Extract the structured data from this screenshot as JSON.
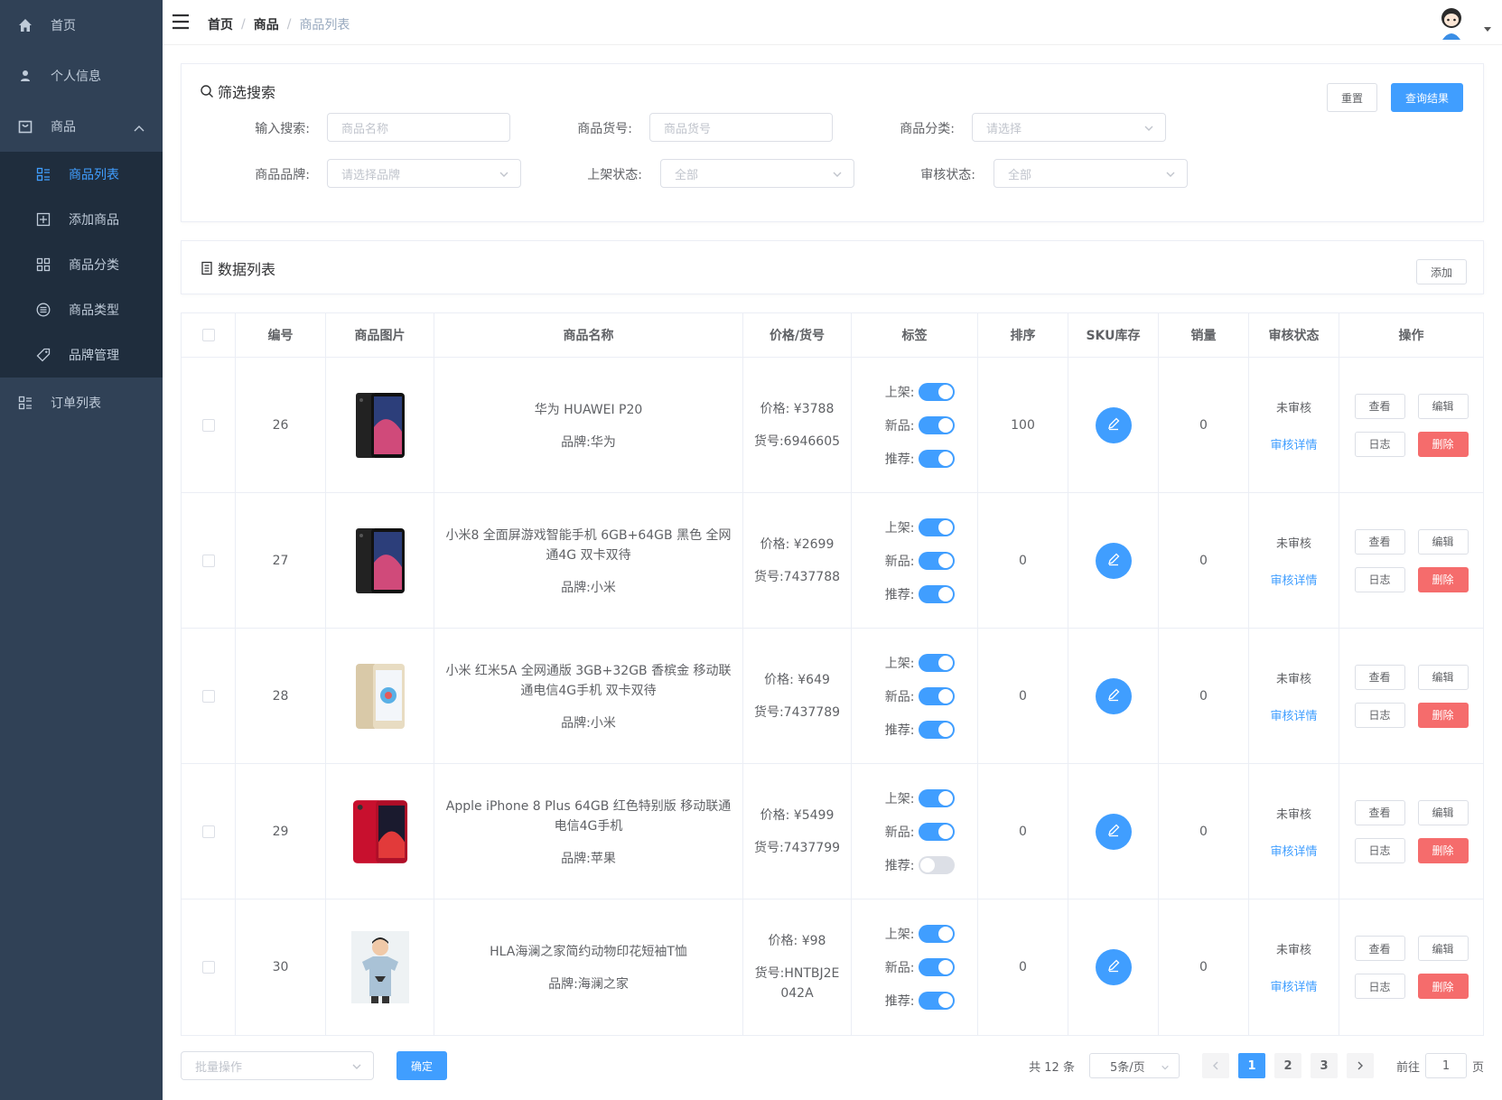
{
  "sidebar": {
    "items": [
      {
        "label": "首页",
        "icon": "home-icon"
      },
      {
        "label": "个人信息",
        "icon": "user-icon"
      },
      {
        "label": "商品",
        "icon": "shopping-bag-icon"
      }
    ],
    "sub_items": [
      {
        "label": "商品列表",
        "icon": "list-icon",
        "active": true
      },
      {
        "label": "添加商品",
        "icon": "add-square-icon"
      },
      {
        "label": "商品分类",
        "icon": "grid-icon"
      },
      {
        "label": "商品类型",
        "icon": "menu-circle-icon"
      },
      {
        "label": "品牌管理",
        "icon": "tag-icon"
      }
    ],
    "order_item": {
      "label": "订单列表",
      "icon": "list-icon"
    }
  },
  "header": {
    "breadcrumb": [
      "首页",
      "商品",
      "商品列表"
    ]
  },
  "filter": {
    "title": "筛选搜索",
    "reset_label": "重置",
    "query_label": "查询结果",
    "fields": {
      "search": {
        "label": "输入搜索:",
        "placeholder": "商品名称"
      },
      "sn": {
        "label": "商品货号:",
        "placeholder": "商品货号"
      },
      "category": {
        "label": "商品分类:",
        "placeholder": "请选择"
      },
      "brand": {
        "label": "商品品牌:",
        "placeholder": "请选择品牌"
      },
      "publish": {
        "label": "上架状态:",
        "placeholder": "全部"
      },
      "verify": {
        "label": "审核状态:",
        "placeholder": "全部"
      }
    }
  },
  "list": {
    "title": "数据列表",
    "add_label": "添加"
  },
  "table": {
    "headers": [
      "编号",
      "商品图片",
      "商品名称",
      "价格/货号",
      "标签",
      "排序",
      "SKU库存",
      "销量",
      "审核状态",
      "操作"
    ],
    "tag_labels": {
      "publish": "上架:",
      "new": "新品:",
      "recommend": "推荐:"
    },
    "price_prefix": "价格: ¥",
    "sn_prefix": "货号:",
    "brand_prefix": "品牌:",
    "audit_detail": "审核详情",
    "ops": {
      "view": "查看",
      "edit": "编辑",
      "log": "日志",
      "delete": "删除"
    },
    "rows": [
      {
        "id": "26",
        "name": "华为 HUAWEI P20",
        "brand": "华为",
        "price": "3788",
        "sn": "6946605",
        "publish": true,
        "new": true,
        "recommend": true,
        "sort": "100",
        "sales": "0",
        "status": "未审核",
        "img": "black-phone"
      },
      {
        "id": "27",
        "name": "小米8 全面屏游戏智能手机 6GB+64GB 黑色 全网通4G 双卡双待",
        "brand": "小米",
        "price": "2699",
        "sn": "7437788",
        "publish": true,
        "new": true,
        "recommend": true,
        "sort": "0",
        "sales": "0",
        "status": "未审核",
        "img": "black-phone"
      },
      {
        "id": "28",
        "name": "小米 红米5A 全网通版 3GB+32GB 香槟金 移动联通电信4G手机 双卡双待",
        "brand": "小米",
        "price": "649",
        "sn": "7437789",
        "publish": true,
        "new": true,
        "recommend": true,
        "sort": "0",
        "sales": "0",
        "status": "未审核",
        "img": "gold-phone"
      },
      {
        "id": "29",
        "name": "Apple iPhone 8 Plus 64GB 红色特别版 移动联通电信4G手机",
        "brand": "苹果",
        "price": "5499",
        "sn": "7437799",
        "publish": true,
        "new": true,
        "recommend": false,
        "sort": "0",
        "sales": "0",
        "status": "未审核",
        "img": "red-phone"
      },
      {
        "id": "30",
        "name": "HLA海澜之家简约动物印花短袖T恤",
        "brand": "海澜之家",
        "price": "98",
        "sn": "HNTBJ2E042A",
        "publish": true,
        "new": true,
        "recommend": true,
        "sort": "0",
        "sales": "0",
        "status": "未审核",
        "img": "tshirt"
      }
    ]
  },
  "footer": {
    "batch_placeholder": "批量操作",
    "confirm_label": "确定",
    "total": "共 12 条",
    "page_size": "5条/页",
    "pages": [
      "1",
      "2",
      "3"
    ],
    "current_page": "1",
    "goto_prefix": "前往",
    "goto_value": "1",
    "goto_suffix": "页"
  },
  "colors": {
    "primary": "#409eff",
    "danger": "#f56c6c",
    "sidebar": "#304156",
    "submenu": "#1f2d3d"
  }
}
